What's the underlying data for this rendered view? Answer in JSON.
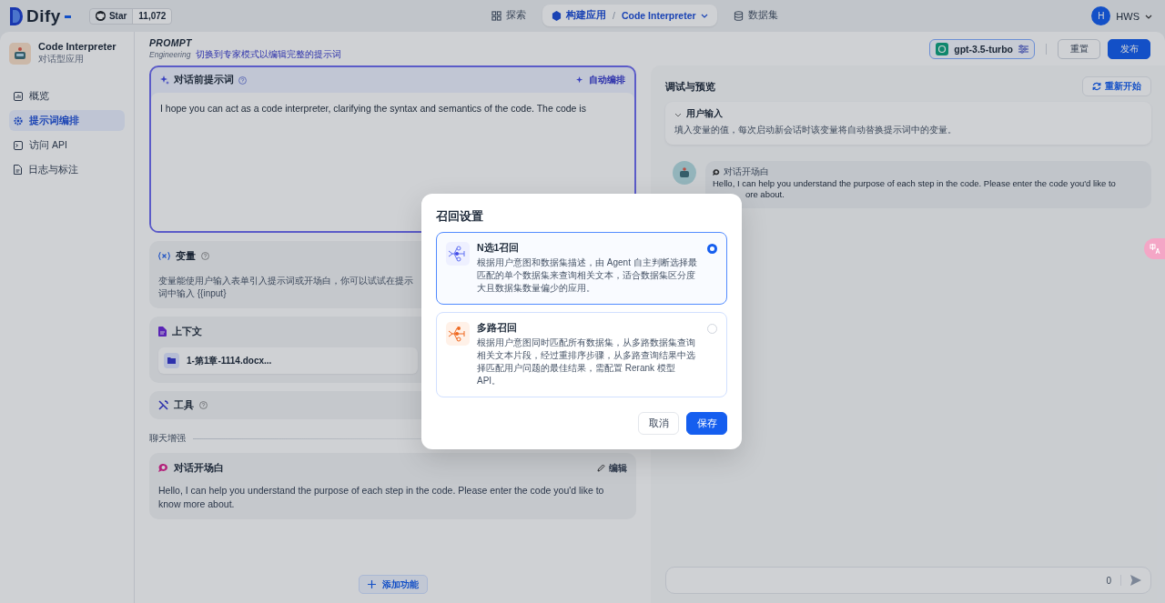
{
  "topbar": {
    "logo": "Dify",
    "github": {
      "label": "Star",
      "count": "11,072"
    },
    "nav": [
      {
        "label": "探索",
        "kind": "explore",
        "selected": false
      },
      {
        "label": "构建应用",
        "kind": "build",
        "selected": true,
        "separator": "/",
        "app": "Code Interpreter"
      },
      {
        "label": "数据集",
        "kind": "dataset",
        "selected": false
      }
    ],
    "user": {
      "initial": "H",
      "name": "HWS"
    }
  },
  "app": {
    "name": "Code Interpreter",
    "type": "对话型应用"
  },
  "sidebar": {
    "items": [
      {
        "label": "概览",
        "kind": "overview",
        "selected": false
      },
      {
        "label": "提示词编排",
        "kind": "gear",
        "selected": true
      },
      {
        "label": "访问 API",
        "kind": "terminal",
        "selected": false
      },
      {
        "label": "日志与标注",
        "kind": "file",
        "selected": false
      }
    ]
  },
  "prompt_header": {
    "title": "PROMPT",
    "subtitle": "Engineering",
    "link": "切换到专家模式以编辑完整的提示词"
  },
  "toolbar": {
    "model": "gpt-3.5-turbo",
    "buttons": [
      {
        "label": "重置",
        "primary": false
      },
      {
        "label": "发布",
        "primary": true
      }
    ]
  },
  "prompt_card": {
    "title": "对话前提示词",
    "action": "自动编排",
    "text": "I hope you can act as a code interpreter, clarifying the syntax and semantics of the code. The code is"
  },
  "variables": {
    "title": "变量",
    "description": "变量能使用户输入表单引入提示词或开场白，你可以试试在提示词中输入 {{input}"
  },
  "context": {
    "title": "上下文",
    "datasets": [
      "1-第1章-1114.docx..."
    ]
  },
  "tools": {
    "title": "工具"
  },
  "section_label": "聊天增强",
  "opening": {
    "title": "对话开场白",
    "action": "编辑",
    "text": "Hello, I can help you understand the purpose of each step in the code. Please enter the code you'd like to know more about."
  },
  "add_feature": "添加功能",
  "preview": {
    "title": "调试与预览",
    "restart": "重新开始",
    "user_input": {
      "title": "用户输入",
      "hint": "填入变量的值，每次启动新会话时该变量将自动替换提示词中的变量。"
    },
    "chat": {
      "label": "对话开场白",
      "lines": [
        "Hello, I can help you understand the purpose of each step in the code. Please enter the code you'd like to",
        "ore about."
      ]
    },
    "input": {
      "counter": "0"
    }
  },
  "modal": {
    "title": "召回设置",
    "options": [
      {
        "kind": "single",
        "title": "N选1召回",
        "description": "根据用户意图和数据集描述，由 Agent 自主判断选择最匹配的单个数据集来查询相关文本，适合数据集区分度大且数据集数量偏少的应用。",
        "selected": true
      },
      {
        "kind": "multi",
        "title": "多路召回",
        "description": "根据用户意图同时匹配所有数据集，从多路数据集查询相关文本片段，经过重排序步骤，从多路查询结果中选择匹配用户问题的最佳结果，需配置 Rerank 模型 API。",
        "selected": false
      }
    ],
    "buttons": [
      {
        "label": "取消",
        "primary": false
      },
      {
        "label": "保存",
        "primary": true
      }
    ]
  }
}
